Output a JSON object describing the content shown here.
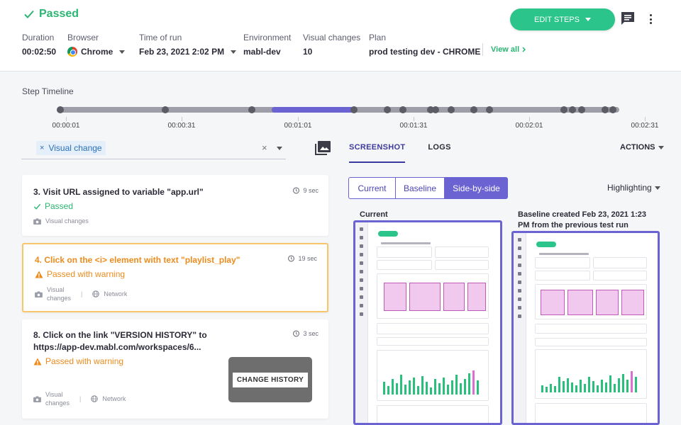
{
  "header": {
    "status": "Passed",
    "duration": {
      "label": "Duration",
      "value": "00:02:50"
    },
    "browser": {
      "label": "Browser",
      "value": "Chrome"
    },
    "time_of_run": {
      "label": "Time of run",
      "value": "Feb 23, 2021 2:02 PM"
    },
    "environment": {
      "label": "Environment",
      "value": "mabl-dev"
    },
    "visual_changes": {
      "label": "Visual changes",
      "value": "10"
    },
    "plan": {
      "label": "Plan",
      "value": "prod testing dev - CHROME"
    },
    "view_all": "View all",
    "edit_steps": "EDIT STEPS"
  },
  "timeline": {
    "title": "Step Timeline",
    "labels": [
      "00:00:01",
      "00:00:31",
      "00:01:01",
      "00:01:31",
      "00:02:01",
      "00:02:31"
    ]
  },
  "filter": {
    "chip": "Visual change",
    "clear": "×"
  },
  "steps": [
    {
      "title": "3. Visit URL assigned to variable \"app.url\"",
      "time": "9 sec",
      "result": "Passed",
      "foot1": "Visual changes"
    },
    {
      "title": "4. Click on the <i> element with text \"playlist_play\"",
      "time": "19 sec",
      "result": "Passed with warning",
      "foot1a": "Visual",
      "foot1b": "changes",
      "foot2": "Network"
    },
    {
      "title": "8. Click on the link \"VERSION HISTORY\" to https://app-dev.mabl.com/workspaces/6...",
      "time": "3 sec",
      "result": "Passed with warning",
      "foot1a": "Visual",
      "foot1b": "changes",
      "foot2": "Network",
      "thumb": "CHANGE HISTORY"
    }
  ],
  "right": {
    "tabs": [
      "SCREENSHOT",
      "LOGS"
    ],
    "actions": "ACTIONS",
    "segments": [
      "Current",
      "Baseline",
      "Side-by-side"
    ],
    "highlighting": "Highlighting",
    "current_label": "Current",
    "baseline_label": "Baseline created Feb 23, 2021 1:23 PM from the previous test run"
  },
  "colors": {
    "accent": "#6a63d1",
    "success": "#2bb673",
    "warning": "#ee8b1c",
    "button": "#2bc48a"
  }
}
